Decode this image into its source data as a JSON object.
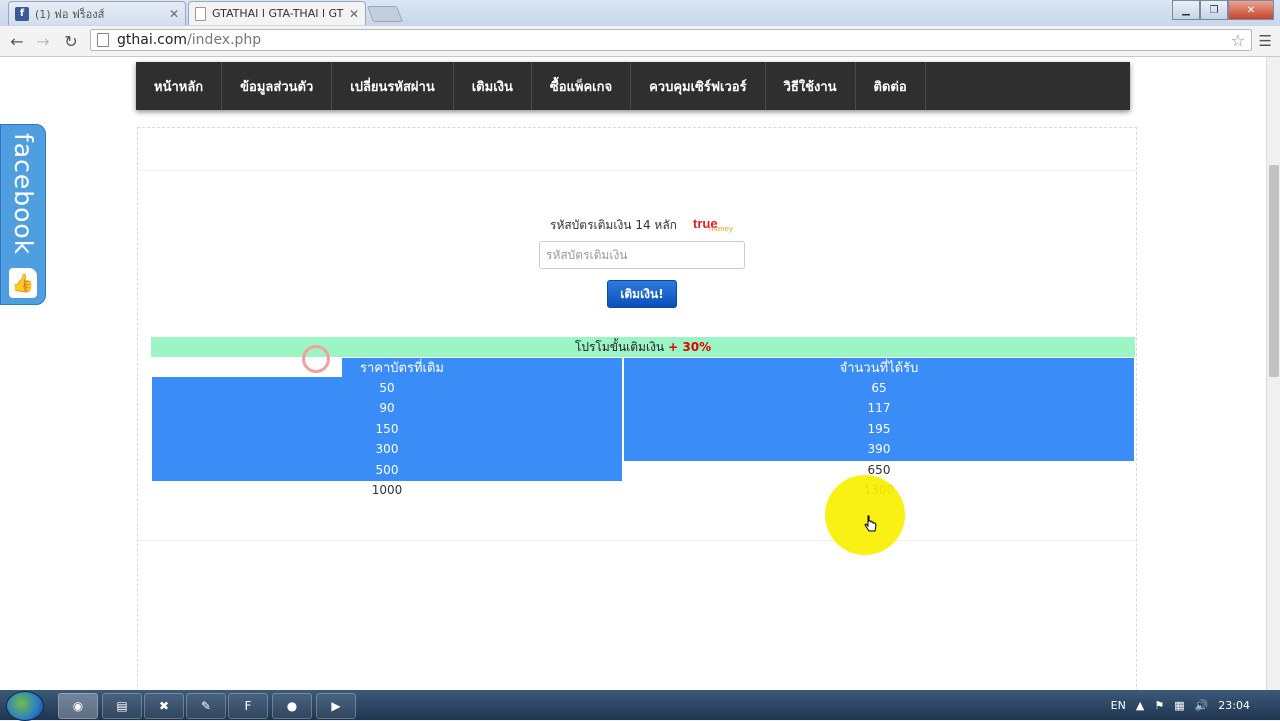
{
  "browser": {
    "tabs": [
      {
        "title": "(1) ฟอ ฟร็องส์",
        "icon": "facebook-icon",
        "active": false
      },
      {
        "title": "GTATHAI l GTA-THAI l GT",
        "icon": "page-icon",
        "active": true
      }
    ],
    "url_host": "gthai.com",
    "url_path": "/index.php"
  },
  "site": {
    "nav": [
      "หน้าหลัก",
      "ข้อมูลส่วนตัว",
      "เปลี่ยนรหัสผ่าน",
      "เติมเงิน",
      "ซื้อแพ็คเกจ",
      "ควบคุมเซิร์ฟเวอร์",
      "วิธีใช้งาน",
      "ติดต่อ"
    ],
    "facebook_tab": "facebook",
    "card_label": "รหัสบัตรเติมเงิน 14 หลัก",
    "brand_logo": {
      "word": "true",
      "sub": "money"
    },
    "code_placeholder": "รหัสบัตรเติมเงิน",
    "submit_label": "เติมเงิน!",
    "promo_text": "โปรโมขั้นเติมเงิน",
    "promo_bonus": "+ 30%",
    "table": {
      "headers": [
        "ราคาบัตรที่เติม",
        "จำนวนที่ได้รับ"
      ],
      "rows": [
        [
          "50",
          "65"
        ],
        [
          "90",
          "117"
        ],
        [
          "150",
          "195"
        ],
        [
          "300",
          "390"
        ],
        [
          "500",
          "650"
        ],
        [
          "1000",
          "1300"
        ]
      ]
    }
  },
  "taskbar": {
    "lang": "EN",
    "time": "23:04"
  },
  "colors": {
    "nav_bg": "#2f2f2f",
    "table_blue": "#3a8cf7",
    "promo_green": "#9cf5c4",
    "bonus_red": "#e00000",
    "button_blue": "#0a50b8"
  }
}
